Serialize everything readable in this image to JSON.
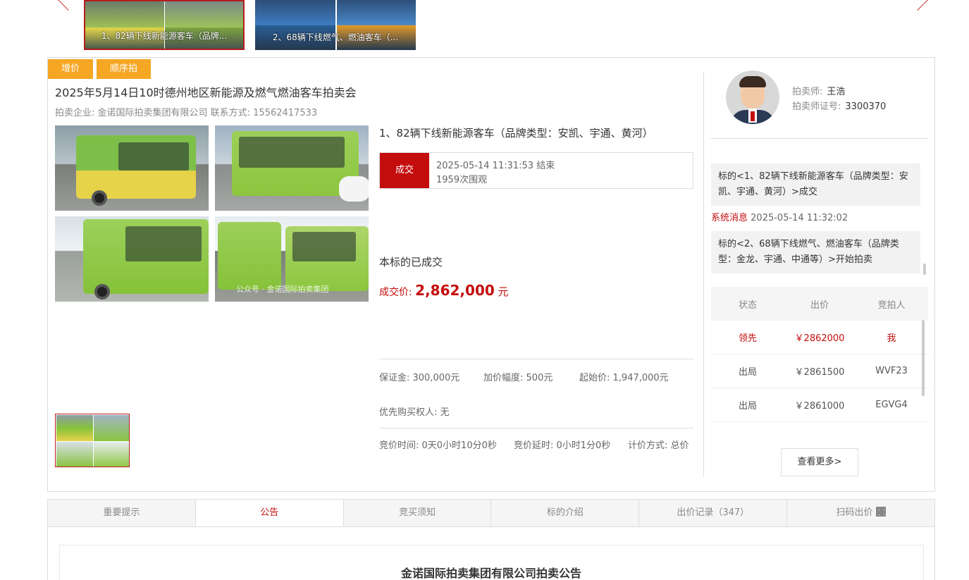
{
  "carousel": {
    "items": [
      {
        "caption": "1、82辆下线新能源客车（品牌..."
      },
      {
        "caption": "2、68辆下线燃气、燃油客车（..."
      }
    ]
  },
  "tags": [
    "增价",
    "顺序拍"
  ],
  "auction": {
    "title": "2025年5月14日10时德州地区新能源及燃气燃油客车拍卖会",
    "company": "拍卖企业: 金诺国际拍卖集团有限公司 联系方式: 15562417533"
  },
  "lot": {
    "title": "1、82辆下线新能源客车（品牌类型：安凯、宇通、黄河）",
    "status": "成交",
    "end_time": "2025-05-14 11:31:53 结束",
    "views": "1959次围观",
    "sold_text": "本标的已成交",
    "price_label": "成交价: ",
    "price_value": "2,862,000",
    "price_unit": " 元",
    "deposit": "保证金: 300,000元",
    "increment": "加价幅度: 500元",
    "start_price": "起始价: 1,947,000元",
    "priority_buyer": "优先购买权人: 无",
    "bid_time": "竞价时间: 0天0小时10分0秒",
    "bid_delay": "竞价延时: 0小时1分0秒",
    "pricing_method": "计价方式: 总价"
  },
  "watermark": "公众号 · 金诺国际拍卖集团",
  "auctioneer": {
    "name_label": "拍卖师:",
    "name": "王浩",
    "id_label": "拍卖师证号:",
    "id": "3300370"
  },
  "messages": {
    "msg1": "标的<1、82辆下线新能源客车（品牌类型：安凯、宇通、黄河）>成交",
    "sys_label": "系统消息",
    "sys_time": " 2025-05-14 11:32:02",
    "msg2": "标的<2、68辆下线燃气、燃油客车（品牌类型：金龙、宇通、中通等）>开始拍卖"
  },
  "bids": {
    "headers": [
      "状态",
      "出价",
      "竞拍人"
    ],
    "rows": [
      {
        "status": "领先",
        "price": "￥2862000",
        "bidder": "我"
      },
      {
        "status": "出局",
        "price": "￥2861500",
        "bidder": "WVF23"
      },
      {
        "status": "出局",
        "price": "￥2861000",
        "bidder": "EGVG4"
      }
    ],
    "more_label": "查看更多>"
  },
  "tabs": [
    "重要提示",
    "公告",
    "竞买须知",
    "标的介绍",
    "出价记录（347）",
    "扫码出价"
  ],
  "announcement": {
    "title": "金诺国际拍卖集团有限公司拍卖公告"
  },
  "colors": {
    "accent": "#c40d0d",
    "tag": "#f5a623",
    "bus_yellow": "#e8d84a",
    "bus_green": "#8cc63f"
  }
}
